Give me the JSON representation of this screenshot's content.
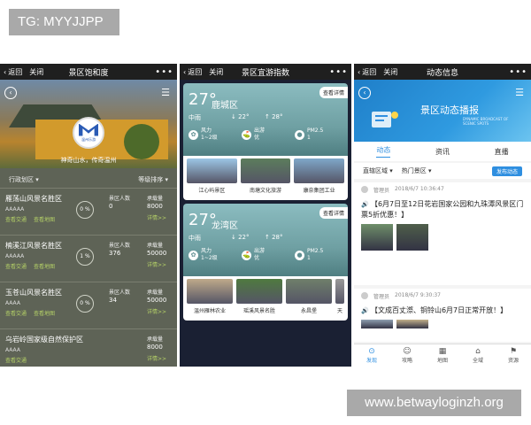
{
  "tag": "TG: MYYJJPP",
  "watermark": "www.betwayloginzh.org",
  "common": {
    "back": "返回",
    "close": "关闭",
    "more": "•••"
  },
  "phone1": {
    "title": "景区饱和度",
    "logo_text": "温州乐游",
    "slogan": "神奇山水，传奇温州",
    "filter_left": "行政划区 ▾",
    "filter_right": "等级排序 ▾",
    "rows": [
      {
        "name": "雁荡山风景名胜区",
        "sub": "AAAAA",
        "links": [
          "查看交通",
          "查看地图"
        ],
        "pct": "0 %",
        "visitors_label": "景区人数",
        "visitors": "0",
        "capacity_label": "承载量",
        "capacity": "8000",
        "detail": "详情>>"
      },
      {
        "name": "楠溪江风景名胜区",
        "sub": "AAAAA",
        "links": [
          "查看交通",
          "查看地图"
        ],
        "pct": "1 %",
        "visitors_label": "景区人数",
        "visitors": "376",
        "capacity_label": "承载量",
        "capacity": "50000",
        "detail": "详情>>"
      },
      {
        "name": "玉苍山风景名胜区",
        "sub": "AAAA",
        "links": [
          "查看交通",
          "查看地图"
        ],
        "pct": "0 %",
        "visitors_label": "景区人数",
        "visitors": "34",
        "capacity_label": "承载量",
        "capacity": "50000",
        "detail": "详情>>"
      },
      {
        "name": "乌岩岭国家级自然保护区",
        "sub": "AAAA",
        "links": [
          "查看交通"
        ],
        "pct": "",
        "visitors_label": "",
        "visitors": "",
        "capacity_label": "承载量",
        "capacity": "8000",
        "detail": "详情>>"
      }
    ]
  },
  "phone2": {
    "title": "景区宜游指数",
    "cards": [
      {
        "more": "查看详情",
        "temp": "27°",
        "city": "鹿城区",
        "weather": "中雨",
        "low": "↓ 22°",
        "high": "↑ 28°",
        "wind_label": "风力",
        "wind": "1~2级",
        "trip_label": "出游",
        "trip": "优",
        "pm_label": "PM2.5",
        "pm": "1",
        "spots": [
          "江心屿景区",
          "南塘文化旅游",
          "康奈集团工业"
        ]
      },
      {
        "more": "查看详情",
        "temp": "27°",
        "city": "龙湾区",
        "weather": "中雨",
        "low": "↓ 22°",
        "high": "↑ 28°",
        "wind_label": "风力",
        "wind": "1~2级",
        "trip_label": "出游",
        "trip": "优",
        "pm_label": "PM2.5",
        "pm": "1",
        "spots": [
          "温州雁林农业",
          "瑶溪风景名胜",
          "永昌堡",
          "天"
        ]
      }
    ]
  },
  "phone3": {
    "title": "动态信息",
    "banner_title": "景区动态播报",
    "banner_en": "DYNAMIC BROADCAST OF SCENIC SPOTS",
    "tabs": [
      "动态",
      "资讯",
      "直播"
    ],
    "filter1": "直辖区域 ▾",
    "filter2": "热门景区 ▾",
    "publish": "发布动态",
    "posts": [
      {
        "author": "管理员",
        "time": "2018/6/7 10:36:47",
        "text": "【6月7日至12日花岩国家公园和九珠潭风景区门票5折优惠！】"
      },
      {
        "author": "管理员",
        "time": "2018/6/7 9:30:37",
        "text": "【文成百丈漈、铜铃山6月7日正常开放！】"
      }
    ],
    "nav": [
      {
        "icon": "⊙",
        "label": "发现"
      },
      {
        "icon": "☺",
        "label": "攻略"
      },
      {
        "icon": "▦",
        "label": "地图"
      },
      {
        "icon": "⌂",
        "label": "全域"
      },
      {
        "icon": "⚑",
        "label": "资源"
      }
    ]
  }
}
